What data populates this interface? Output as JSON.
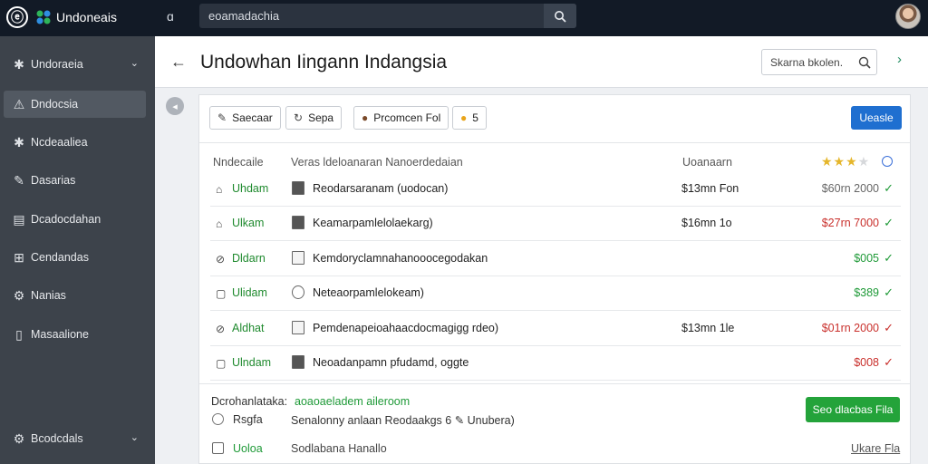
{
  "app": {
    "name": "Undoneais"
  },
  "topbar": {
    "search_value": "eoamadachia",
    "back_glyph": "ɑ"
  },
  "sidebar": {
    "items": [
      {
        "label": "Undoraeia",
        "icon": "puzzle-icon",
        "glyph": "✱",
        "chevron": true,
        "active": false
      },
      {
        "label": "Dndocsia",
        "icon": "person-icon",
        "glyph": "⚠",
        "chevron": false,
        "active": true
      },
      {
        "label": "Ncdeaaliea",
        "icon": "tool-icon",
        "glyph": "✱",
        "chevron": false,
        "active": false
      },
      {
        "label": "Dasarias",
        "icon": "edit-icon",
        "glyph": "✎",
        "chevron": false,
        "active": false
      },
      {
        "label": "Dcadocdahan",
        "icon": "list-icon",
        "glyph": "▤",
        "chevron": false,
        "active": false
      },
      {
        "label": "Cendandas",
        "icon": "grid-icon",
        "glyph": "⊞",
        "chevron": false,
        "active": false
      },
      {
        "label": "Nanias",
        "icon": "user-settings-icon",
        "glyph": "⚙",
        "chevron": false,
        "active": false
      },
      {
        "label": "Masaalione",
        "icon": "document-icon",
        "glyph": "▯",
        "chevron": false,
        "active": false
      }
    ],
    "bottom": {
      "label": "Bcodcdals",
      "icon": "settings-icon",
      "glyph": "⚙"
    }
  },
  "header": {
    "title": "Undowhan Iingann Indangsia",
    "search_value": "Skarna bkolen.",
    "back_glyph": "←",
    "next_glyph": "›"
  },
  "toolbar": {
    "chips": [
      {
        "label": "Saecaar",
        "icon": "edit-icon",
        "glyph": "✎"
      },
      {
        "label": "Sepa",
        "icon": "refresh-icon",
        "glyph": "↻"
      },
      {
        "label": "Prcomcen Fol",
        "icon": "user-icon",
        "glyph": "●"
      },
      {
        "label": "5",
        "icon": "coin-icon",
        "glyph": "●"
      }
    ],
    "primary_label": "Ueasle"
  },
  "table": {
    "columns": [
      "Nndecaile",
      "Veras ldeloanaran Nanoerdedaian",
      "Uoanaarn"
    ],
    "rows": [
      {
        "icon": "home-icon",
        "glyph": "⌂",
        "status": "Uhdam",
        "doc": "dark",
        "name": "Reodarsaranam (uodocan)",
        "price": "$13mn Fon",
        "amount": "$60rn 2000",
        "amount_color": "grey",
        "check": "✓",
        "check_color": "green"
      },
      {
        "icon": "home-icon",
        "glyph": "⌂",
        "status": "Ulkam",
        "doc": "dark",
        "name": "Keamarpamlelolaekarg)",
        "price": "$16mn 1o",
        "amount": "$27rn 7000",
        "amount_color": "red",
        "check": "✓",
        "check_color": "green"
      },
      {
        "icon": "edit-icon",
        "glyph": "⊘",
        "status": "Dldarn",
        "doc": "light",
        "name": "Kemdoryclamnahanooocegodakan",
        "price": "",
        "amount": "$005",
        "amount_color": "green",
        "check": "✓",
        "check_color": "green"
      },
      {
        "icon": "checkbox-icon",
        "glyph": "▢",
        "status": "Ulidam",
        "doc": "clock",
        "name": "Neteaorpamlelokeam)",
        "price": "",
        "amount": "$389",
        "amount_color": "green",
        "check": "✓",
        "check_color": "green"
      },
      {
        "icon": "edit-icon",
        "glyph": "⊘",
        "status": "Aldhat",
        "doc": "light",
        "name": "Pemdenapeioahaacdocmagigg rdeo)",
        "price": "$13mn 1le",
        "amount": "$01rn 2000",
        "amount_color": "red",
        "check": "✓",
        "check_color": "red"
      },
      {
        "icon": "checkbox-icon",
        "glyph": "▢",
        "status": "Ulndam",
        "doc": "dark",
        "name": "Neoadanpamn pfudamd, oggte",
        "price": "",
        "amount": "$008",
        "amount_color": "red",
        "check": "✓",
        "check_color": "red"
      }
    ],
    "rating": "★★★★"
  },
  "footer": {
    "label": "Dcrohanlataka:",
    "link": "aoaoaeladem aileroom",
    "tag": "Rsgfa",
    "info": "Senalonny anlaan  Reodaakgs  6  ✎  Unubera)",
    "green_button": "Seo dlacbas Fila",
    "status": "Uoloa",
    "desc": "Sodlabana Hanallo",
    "link2": "Ukare Fla"
  }
}
